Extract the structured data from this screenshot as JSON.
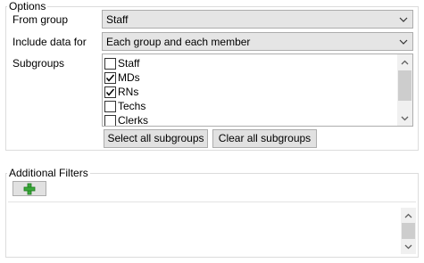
{
  "options": {
    "title": "Options",
    "from_group": {
      "label": "From group",
      "value": "Staff"
    },
    "include_data_for": {
      "label": "Include data for",
      "value": "Each group and each member"
    },
    "subgroups": {
      "label": "Subgroups",
      "items": [
        {
          "label": "Staff",
          "checked": false
        },
        {
          "label": "MDs",
          "checked": true
        },
        {
          "label": "RNs",
          "checked": true
        },
        {
          "label": "Techs",
          "checked": false
        },
        {
          "label": "Clerks",
          "checked": false
        }
      ]
    },
    "select_all_label": "Select all subgroups",
    "clear_all_label": "Clear all subgroups"
  },
  "additional_filters": {
    "title": "Additional Filters",
    "add_icon": "green-plus-icon"
  },
  "colors": {
    "plus_green": "#3aa83a",
    "plus_green_dark": "#1f7a1f",
    "combo_bg": "#e5e5e5",
    "button_bg": "#e1e1e1",
    "border": "#adadad"
  }
}
